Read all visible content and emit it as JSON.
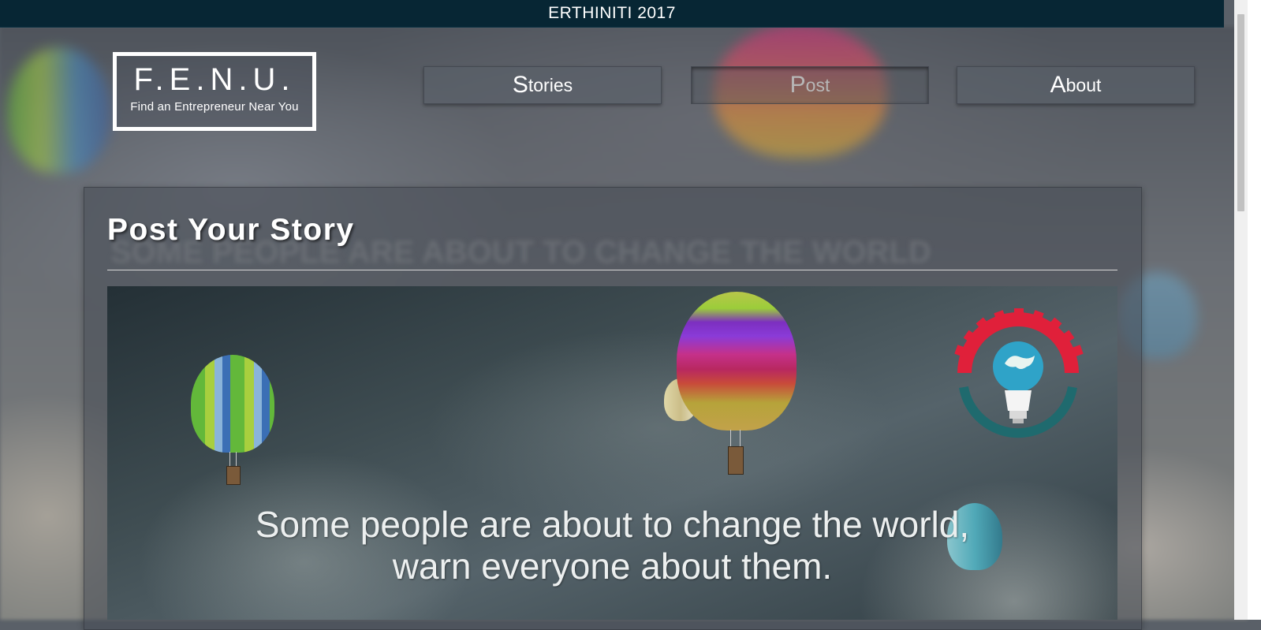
{
  "topbar": {
    "title": "ERTHINITI 2017"
  },
  "logo": {
    "mark": "F.E.N.U.",
    "tagline": "Find an Entrepreneur Near You"
  },
  "nav": {
    "items": [
      {
        "initial": "S",
        "rest": "tories",
        "active": false
      },
      {
        "initial": "P",
        "rest": "ost",
        "active": true
      },
      {
        "initial": "A",
        "rest": "bout",
        "active": false
      }
    ]
  },
  "page": {
    "title": "Post Your Story",
    "ghost_text": "SOME PEOPLE ARE ABOUT TO CHANGE THE WORLD"
  },
  "hero": {
    "quote_line1": "Some people are about to change the world,",
    "quote_line2": "warn everyone about them."
  },
  "colors": {
    "topbar": "#072634",
    "badge_red": "#e0203a",
    "badge_teal": "#1f6a6e"
  },
  "icons": [
    "hot-air-balloon-icon",
    "gear-lightbulb-badge-icon"
  ]
}
